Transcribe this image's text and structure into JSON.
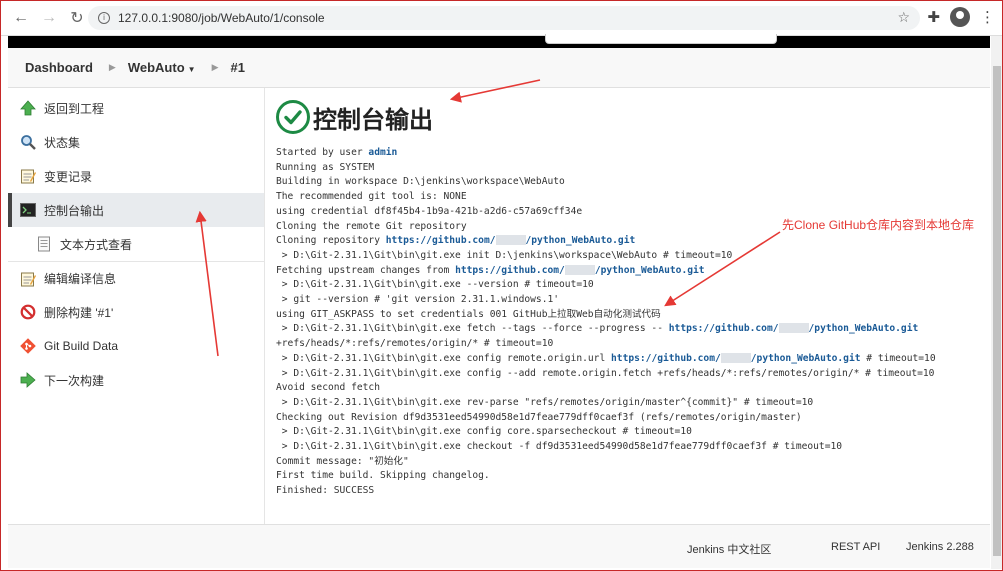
{
  "browser": {
    "url": "127.0.0.1:9080/job/WebAuto/1/console"
  },
  "breadcrumb": {
    "items": [
      "Dashboard",
      "WebAuto",
      "#1"
    ]
  },
  "sidebar": {
    "items": [
      {
        "label": "返回到工程",
        "icon": "up-arrow-icon"
      },
      {
        "label": "状态集",
        "icon": "search-icon"
      },
      {
        "label": "变更记录",
        "icon": "notepad-icon"
      },
      {
        "label": "控制台输出",
        "icon": "terminal-icon"
      },
      {
        "label": "文本方式查看",
        "icon": "document-icon"
      },
      {
        "label": "编辑编译信息",
        "icon": "notepad-icon"
      },
      {
        "label": "删除构建 '#1'",
        "icon": "no-entry-icon"
      },
      {
        "label": "Git Build Data",
        "icon": "git-icon"
      },
      {
        "label": "下一次构建",
        "icon": "right-arrow-icon"
      }
    ]
  },
  "main": {
    "title": "控制台输出",
    "lines": [
      {
        "text": "Started by user ",
        "link": "admin"
      },
      {
        "text": "Running as SYSTEM"
      },
      {
        "text": "Building in workspace D:\\jenkins\\workspace\\WebAuto"
      },
      {
        "text": "The recommended git tool is: NONE"
      },
      {
        "text": "using credential df8f45b4-1b9a-421b-a2d6-c57a69cff34e"
      },
      {
        "text": "Cloning the remote Git repository"
      },
      {
        "text": "Cloning repository ",
        "link": "https://github.com/",
        "blur": true,
        "link2": "/python_WebAuto.git"
      },
      {
        "text": " > D:\\Git-2.31.1\\Git\\bin\\git.exe init D:\\jenkins\\workspace\\WebAuto # timeout=10"
      },
      {
        "text": "Fetching upstream changes from ",
        "link": "https://github.com/",
        "blur": true,
        "link2": "/python_WebAuto.git"
      },
      {
        "text": " > D:\\Git-2.31.1\\Git\\bin\\git.exe --version # timeout=10"
      },
      {
        "text": " > git --version # 'git version 2.31.1.windows.1'"
      },
      {
        "text": "using GIT_ASKPASS to set credentials 001 GitHub上拉取Web自动化测试代码"
      },
      {
        "text": " > D:\\Git-2.31.1\\Git\\bin\\git.exe fetch --tags --force --progress -- ",
        "link": "https://github.com/",
        "blur": true,
        "link2": "/python_WebAuto.git"
      },
      {
        "text": "+refs/heads/*:refs/remotes/origin/* # timeout=10"
      },
      {
        "text": " > D:\\Git-2.31.1\\Git\\bin\\git.exe config remote.origin.url ",
        "link": "https://github.com/",
        "blur": true,
        "link2": "/python_WebAuto.git",
        "tail": " # timeout=10"
      },
      {
        "text": " > D:\\Git-2.31.1\\Git\\bin\\git.exe config --add remote.origin.fetch +refs/heads/*:refs/remotes/origin/* # timeout=10"
      },
      {
        "text": "Avoid second fetch"
      },
      {
        "text": " > D:\\Git-2.31.1\\Git\\bin\\git.exe rev-parse \"refs/remotes/origin/master^{commit}\" # timeout=10"
      },
      {
        "text": "Checking out Revision df9d3531eed54990d58e1d7feae779dff0caef3f (refs/remotes/origin/master)"
      },
      {
        "text": " > D:\\Git-2.31.1\\Git\\bin\\git.exe config core.sparsecheckout # timeout=10"
      },
      {
        "text": " > D:\\Git-2.31.1\\Git\\bin\\git.exe checkout -f df9d3531eed54990d58e1d7feae779dff0caef3f # timeout=10"
      },
      {
        "text": "Commit message: \"初始化\""
      },
      {
        "text": "First time build. Skipping changelog."
      },
      {
        "text": "Finished: SUCCESS"
      }
    ]
  },
  "annotation": {
    "text": "先Clone GitHub仓库内容到本地仓库",
    "color": "#e53935"
  },
  "footer": {
    "community": "Jenkins 中文社区",
    "rest_api": "REST API",
    "version": "Jenkins 2.288"
  },
  "colors": {
    "success": "#1d8a44",
    "link": "#1a5a96"
  }
}
